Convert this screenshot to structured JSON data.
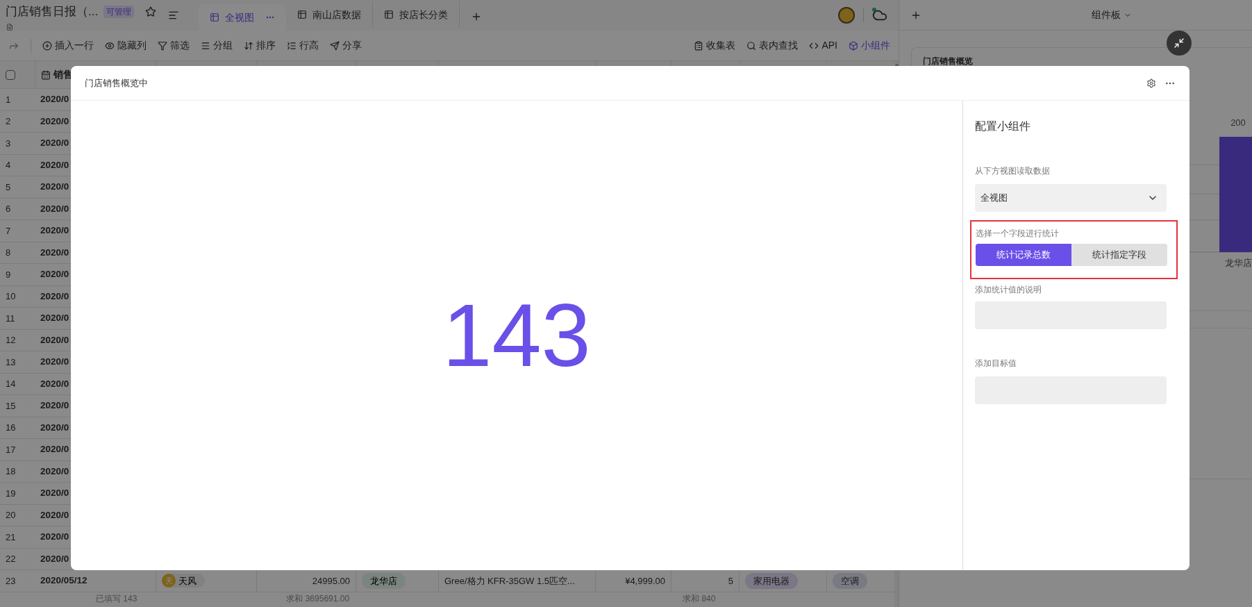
{
  "doc": {
    "title": "门店销售日报（...",
    "badge": "可管理"
  },
  "view_tabs": [
    {
      "label": "全视图",
      "selected": true
    },
    {
      "label": "南山店数据",
      "selected": false
    },
    {
      "label": "按店长分类",
      "selected": false
    }
  ],
  "toolbar_left": [
    "插入一行",
    "隐藏列",
    "筛选",
    "分组",
    "排序",
    "行高",
    "分享"
  ],
  "toolbar_right": [
    {
      "label": "收集表",
      "selected": false
    },
    {
      "label": "表内查找",
      "selected": false
    },
    {
      "label": "API",
      "selected": false
    },
    {
      "label": "小组件",
      "selected": true
    }
  ],
  "table": {
    "date_header": "销售",
    "select_all": {
      "checked": false
    },
    "rows": [
      {
        "number": "1",
        "date": "2020/0"
      },
      {
        "number": "2",
        "date": "2020/0"
      },
      {
        "number": "3",
        "date": "2020/0"
      },
      {
        "number": "4",
        "date": "2020/0"
      },
      {
        "number": "5",
        "date": "2020/0"
      },
      {
        "number": "6",
        "date": "2020/0"
      },
      {
        "number": "7",
        "date": "2020/0"
      },
      {
        "number": "8",
        "date": "2020/0"
      },
      {
        "number": "9",
        "date": "2020/0"
      },
      {
        "number": "10",
        "date": "2020/0"
      },
      {
        "number": "11",
        "date": "2020/0"
      },
      {
        "number": "12",
        "date": "2020/0"
      },
      {
        "number": "13",
        "date": "2020/0"
      },
      {
        "number": "14",
        "date": "2020/0"
      },
      {
        "number": "15",
        "date": "2020/0"
      },
      {
        "number": "16",
        "date": "2020/0"
      },
      {
        "number": "17",
        "date": "2020/0"
      },
      {
        "number": "18",
        "date": "2020/0"
      },
      {
        "number": "19",
        "date": "2020/0"
      },
      {
        "number": "20",
        "date": "2020/0"
      },
      {
        "number": "21",
        "date": "2020/0"
      },
      {
        "number": "22",
        "date": "2020/0"
      },
      {
        "number": "23",
        "date": "2020/05/12",
        "seller_initial": "天",
        "seller": "天风",
        "amount": "24995.00",
        "store": "龙华店",
        "product": "Gree/格力 KFR-35GW 1.5匹空...",
        "price": "¥4,999.00",
        "quantity": "5",
        "category": "家用电器",
        "subcategory": "空调"
      }
    ],
    "footer": [
      "已填写 143",
      "求和 3695691.00",
      "求和 840"
    ]
  },
  "widget_board": {
    "title": "组件板",
    "card_title": "门店销售概览",
    "chart_data": {
      "type": "bar",
      "categories": [
        "龙华店"
      ],
      "values": [
        200
      ],
      "data_labels": true
    }
  },
  "modal": {
    "title": "门店销售概览中",
    "value": "143",
    "config": {
      "title": "配置小组件",
      "source_label": "从下方视图读取数据",
      "source_value": "全视图",
      "stat_label": "选择一个字段进行统计",
      "stat_highlighted": true,
      "stat_options": [
        {
          "label": "统计记录总数",
          "selected": true
        },
        {
          "label": "统计指定字段",
          "selected": false
        }
      ],
      "description_label": "添加统计值的说明",
      "target_label": "添加目标值"
    }
  }
}
